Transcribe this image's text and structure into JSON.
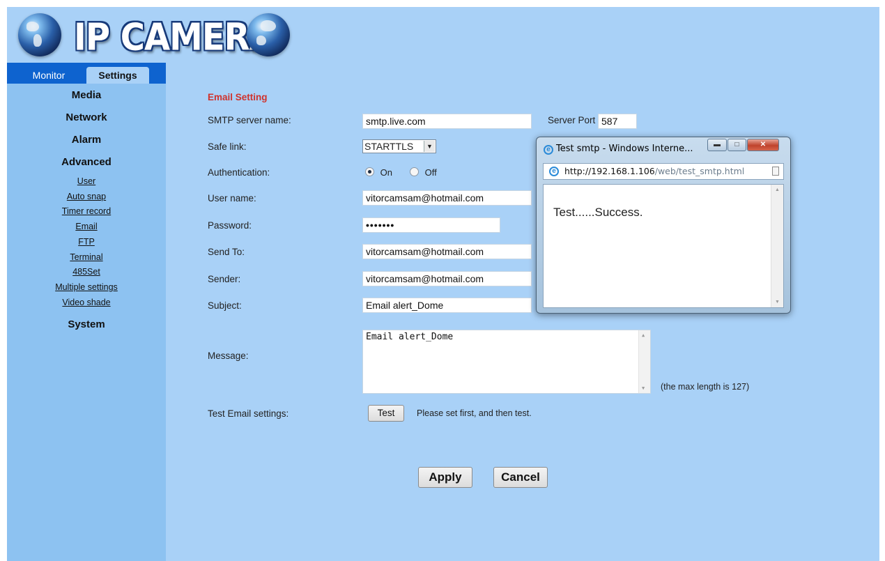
{
  "header": {
    "logo_text": "IP CAMERA"
  },
  "sidebar": {
    "tabs": [
      {
        "label": "Monitor"
      },
      {
        "label": "Settings"
      }
    ],
    "sections": [
      {
        "label": "Media"
      },
      {
        "label": "Network"
      },
      {
        "label": "Alarm"
      },
      {
        "label": "Advanced"
      },
      {
        "label": "System"
      }
    ],
    "advanced_items": [
      {
        "label": "User"
      },
      {
        "label": "Auto snap"
      },
      {
        "label": "Timer record"
      },
      {
        "label": "Email"
      },
      {
        "label": "FTP"
      },
      {
        "label": "Terminal"
      },
      {
        "label": "485Set"
      },
      {
        "label": "Multiple settings"
      },
      {
        "label": "Video shade"
      }
    ]
  },
  "form": {
    "heading": "Email Setting",
    "smtp_server": {
      "label": "SMTP server name:",
      "value": "smtp.live.com"
    },
    "server_port": {
      "label": "Server Port",
      "value": "587"
    },
    "safe_link": {
      "label": "Safe link:",
      "value": "STARTTLS"
    },
    "authentication": {
      "label": "Authentication:",
      "on_label": "On",
      "off_label": "Off",
      "selected": "On"
    },
    "user_name": {
      "label": "User name:",
      "value": "vitorcamsam@hotmail.com"
    },
    "password": {
      "label": "Password:",
      "value": "•••••••"
    },
    "send_to": {
      "label": "Send To:",
      "value": "vitorcamsam@hotmail.com"
    },
    "sender": {
      "label": "Sender:",
      "value": "vitorcamsam@hotmail.com"
    },
    "subject": {
      "label": "Subject:",
      "value": "Email alert_Dome"
    },
    "message": {
      "label": "Message:",
      "value": "Email alert_Dome",
      "hint": "(the max length is 127)"
    },
    "test": {
      "label": "Test Email settings:",
      "button": "Test",
      "hint": "Please set first, and then test."
    },
    "apply_button": "Apply",
    "cancel_button": "Cancel"
  },
  "popup": {
    "title": "Test smtp - Windows Interne...",
    "address_host": "http://192.168.1.106",
    "address_path": "/web/test_smtp.html",
    "message": "Test......Success."
  }
}
